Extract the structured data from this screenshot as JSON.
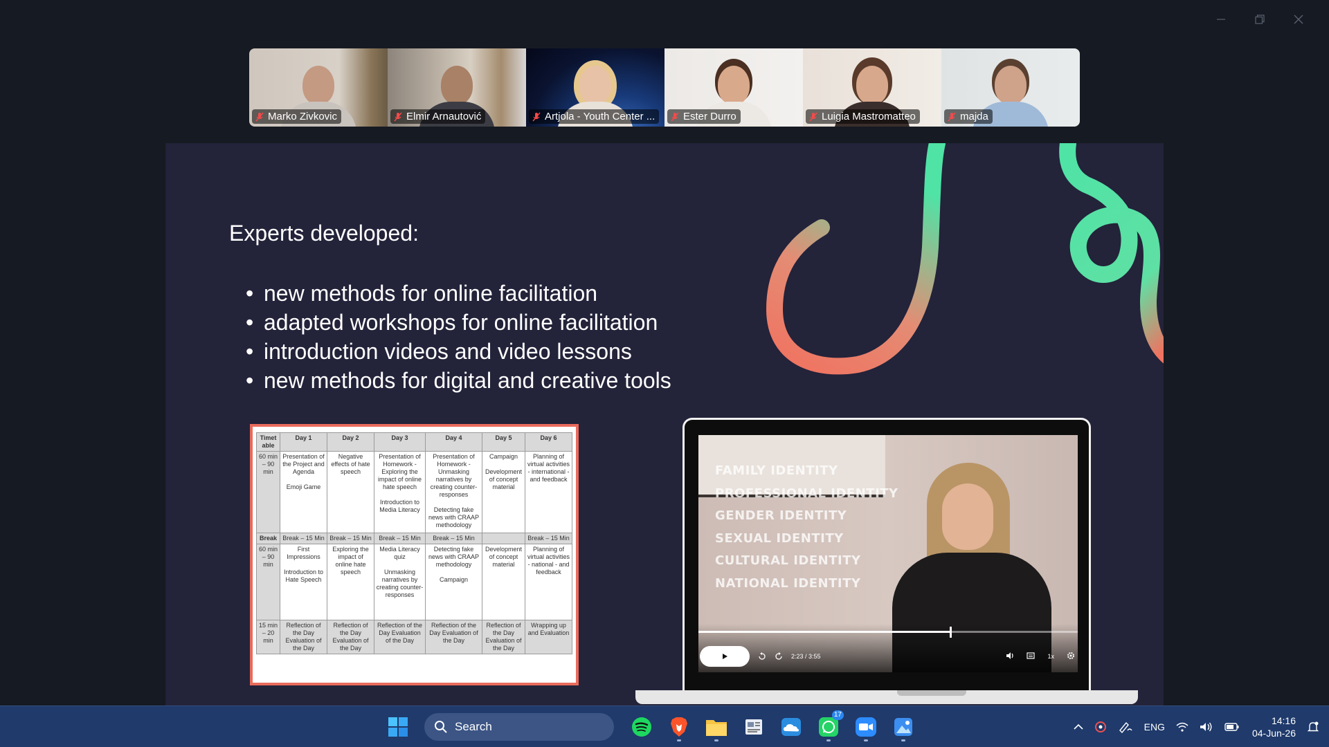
{
  "participants": [
    {
      "name": "Marko Zivkovic",
      "muted": true
    },
    {
      "name": "Elmir Arnautović",
      "muted": true
    },
    {
      "name": "Artjola - Youth Center ...",
      "muted": true
    },
    {
      "name": "Ester Durro",
      "muted": true
    },
    {
      "name": "Luigia Mastromatteo",
      "muted": true
    },
    {
      "name": "majda",
      "muted": true
    }
  ],
  "slide": {
    "title": "Experts developed:",
    "bullets": [
      "new methods for online facilitation",
      "adapted workshops for online facilitation",
      "introduction videos and video lessons",
      "new methods for digital and creative tools"
    ],
    "timetable": {
      "headers": [
        "Timet able",
        "Day 1",
        "Day 2",
        "Day 3",
        "Day 4",
        "Day 5",
        "Day 6"
      ],
      "rows": [
        [
          "60 min – 90 min",
          "Presentation of the Project and Agenda\n\nEmoji Game",
          "Negative effects of hate speech",
          "Presentation of Homework - Exploring the impact of online hate speech\n\nIntroduction to Media Literacy",
          "Presentation of Homework - Unmasking narratives by creating counter-responses\n\nDetecting fake news with CRAAP methodology",
          "Campaign\n\nDevelopment of concept material",
          "Planning of virtual activities - international - and feedback"
        ],
        [
          "Break",
          "Break – 15 Min",
          "Break – 15 Min",
          "Break – 15 Min",
          "Break – 15 Min",
          "",
          "Break – 15 Min"
        ],
        [
          "60 min – 90 min",
          "First Impressions\n\nIntroduction to Hate Speech",
          "Exploring the impact of online hate speech",
          "Media Literacy quiz\n\nUnmasking narratives by creating counter-responses",
          "Detecting fake news with CRAAP methodology\n\nCampaign",
          "Development of concept material",
          "Planning of virtual activities - national - and feedback"
        ],
        [
          "15 min – 20 min",
          "Reflection of the Day Evaluation of the Day",
          "Reflection of the Day Evaluation of the Day",
          "Reflection of the Day Evaluation of the Day",
          "Reflection of the Day Evaluation of the Day",
          "Reflection of the Day Evaluation of the Day",
          "Wrapping up and Evaluation"
        ]
      ]
    },
    "video": {
      "overlay_lines": [
        "FAMILY IDENTITY",
        "PROFESSIONAL IDENTITY",
        "GENDER IDENTITY",
        "SEXUAL IDENTITY",
        "CULTURAL IDENTITY",
        "NATIONAL IDENTITY"
      ],
      "time": "2:23 / 3:55",
      "progress": 0.665,
      "speed": "1x"
    }
  },
  "taskbar": {
    "search_label": "Search",
    "whatsapp_badge": "17",
    "language": "ENG",
    "time": "14:16",
    "date": "04-Jun-26"
  },
  "colors": {
    "accent_coral": "#f07260",
    "accent_mint": "#4fe3a6",
    "slide_bg": "#23233a",
    "taskbar_bg": "#1f3a6b"
  }
}
